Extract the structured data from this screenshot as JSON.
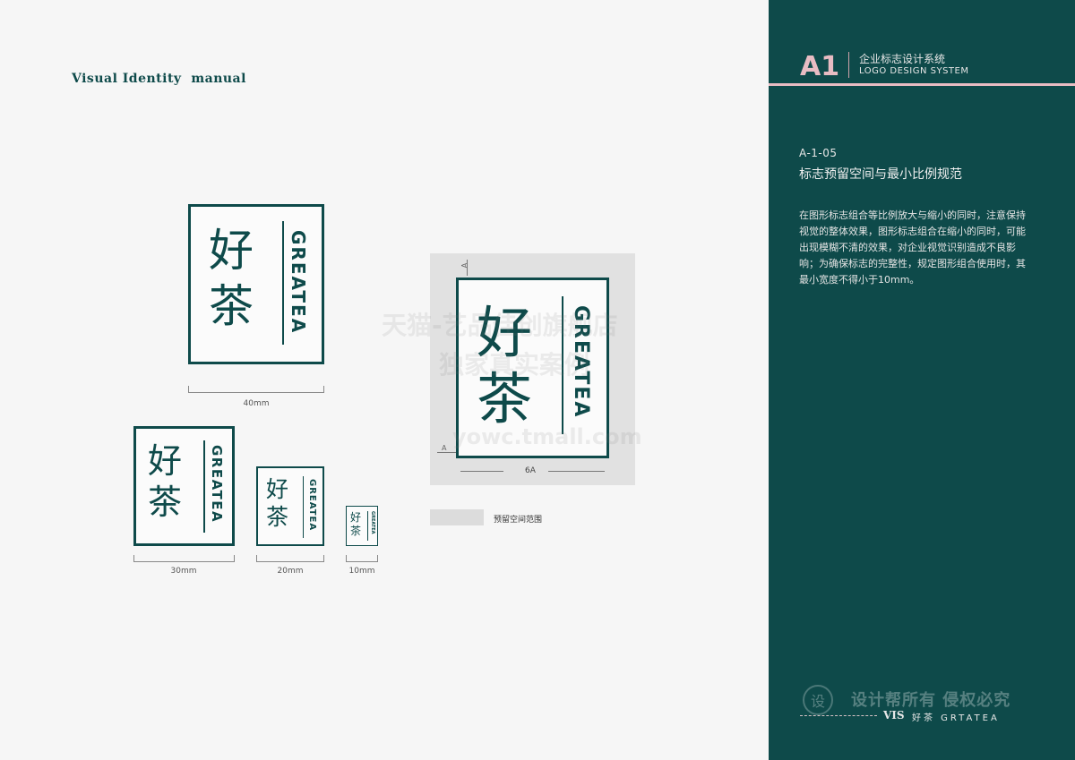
{
  "header": {
    "title": "Visual Identity  manual"
  },
  "logo": {
    "cn_line1": "好",
    "cn_line2": "茶",
    "en": "GREATEA"
  },
  "sizes": [
    {
      "label": "40mm"
    },
    {
      "label": "30mm"
    },
    {
      "label": "20mm"
    },
    {
      "label": "10mm"
    }
  ],
  "clear_space": {
    "unit_label": "A",
    "width_label": "6A",
    "legend_label": "预留空间范围"
  },
  "watermark": {
    "line1": "天猫-艺品佳创旗舰店",
    "line2": "独家真实案例",
    "line3": "yowc.tmall.com"
  },
  "panel": {
    "section_code": "A1",
    "section_cn": "企业标志设计系统",
    "section_en": "LOGO DESIGN SYSTEM",
    "page_code": "A-1-05",
    "heading": "标志预留空间与最小比例规范",
    "body": "在图形标志组合等比例放大与缩小的同时，注意保持视觉的整体效果，图形标志组合在缩小的同时，可能出现模糊不清的效果，对企业视觉识别造成不良影响；为确保标志的完整性，规定图形组合使用时，其最小宽度不得小于10mm。",
    "footer_icon": "设",
    "footer_watermark": "设计帮所有 侵权必究",
    "footer_vis": "VIS",
    "footer_brand": "好茶 GRTATEA"
  },
  "colors": {
    "brand_green": "#0e4a4a",
    "accent_pink": "#e8bcc3",
    "clear_space_gray": "#e1e1e1"
  }
}
